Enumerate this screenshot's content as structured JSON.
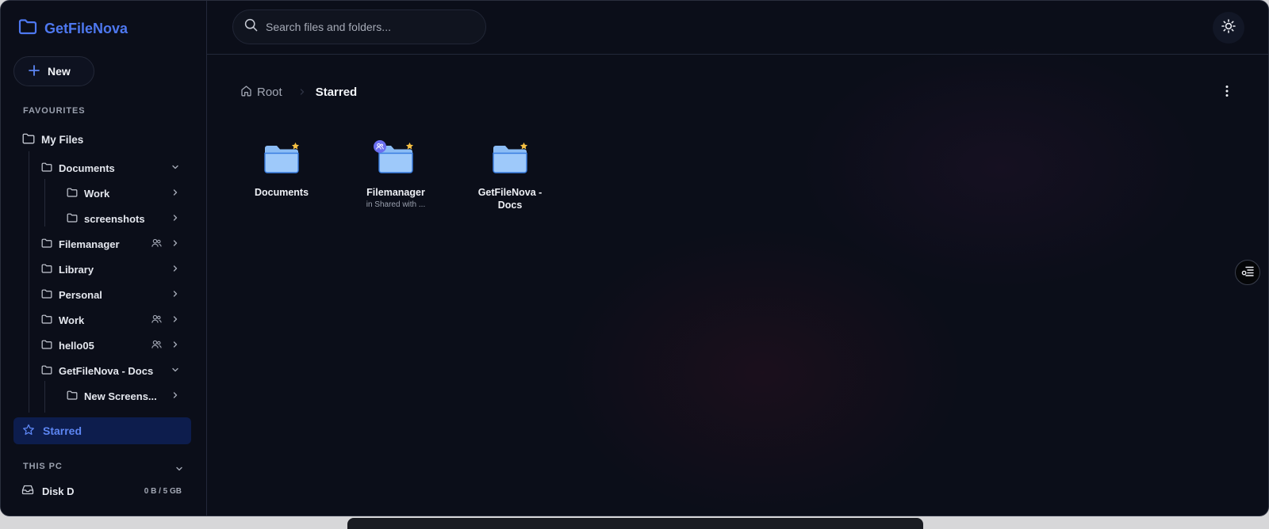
{
  "app": {
    "name": "GetFileNova"
  },
  "sidebar": {
    "new_label": "New",
    "favourites_label": "FAVOURITES",
    "my_files_label": "My Files",
    "tree": {
      "documents": "Documents",
      "work_sub": "Work",
      "screenshots": "screenshots",
      "filemanager": "Filemanager",
      "library": "Library",
      "personal": "Personal",
      "work": "Work",
      "hello05": "hello05",
      "getfilenova_docs": "GetFileNova - Docs",
      "new_screens": "New Screens..."
    },
    "starred_label": "Starred",
    "this_pc_label": "THIS PC",
    "disk": {
      "label": "Disk D",
      "usage": "0 B / 5 GB"
    }
  },
  "search": {
    "placeholder": "Search files and folders..."
  },
  "breadcrumb": {
    "root": "Root",
    "current": "Starred"
  },
  "files": [
    {
      "name": "Documents",
      "subtitle": ""
    },
    {
      "name": "Filemanager",
      "subtitle": "in Shared with ..."
    },
    {
      "name": "GetFileNova - Docs",
      "subtitle": ""
    }
  ],
  "colors": {
    "accent": "#4e78f0",
    "background": "#0b0e19",
    "folder_fill": "#8bbcf5",
    "star": "#f6c043",
    "active_bg": "#0d1d4d"
  }
}
